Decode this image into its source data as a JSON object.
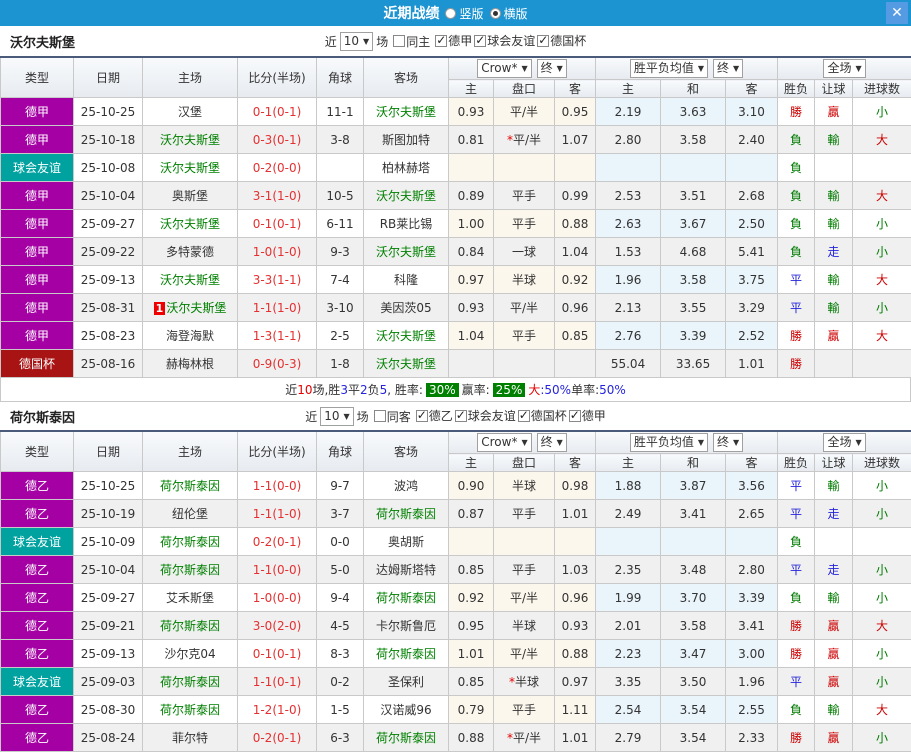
{
  "titlebar": {
    "title": "近期战绩",
    "radio_vertical": "竖版",
    "radio_horizontal": "横版",
    "close": "✕"
  },
  "colors": {
    "titlebar_blue": "#1d94d2",
    "close_button_blue": "#549be4",
    "team_name_green": "#008000",
    "score_red": "#e63030",
    "summary_badge_green": "#008000"
  },
  "type_colors": {
    "德甲": "#a400a4",
    "德乙": "#a400a4",
    "球会友谊": "#00a2a0",
    "德国杯": "#a81414"
  },
  "result_colors": {
    "勝": "#cc0000",
    "贏": "#cc0000",
    "大": "#cc0000",
    "平": "#2424dd",
    "走": "#2424dd",
    "負": "#007a00",
    "輸": "#007a00",
    "小": "#007a00"
  },
  "table_header": {
    "type": "类型",
    "date": "日期",
    "home": "主场",
    "score": "比分(半场)",
    "corner": "角球",
    "away": "客场",
    "odds_source": "Crow*",
    "odds_final": "终",
    "avg_source": "胜平负均值",
    "avg_final": "终",
    "scope": "全场",
    "odds_home": "主",
    "odds_line": "盘口",
    "odds_away": "客",
    "avg_home": "主",
    "avg_draw": "和",
    "avg_away": "客",
    "wdl": "胜负",
    "handicap": "让球",
    "goals": "进球数"
  },
  "teams": [
    {
      "name": "沃尔夫斯堡",
      "filter": {
        "near": "近",
        "games_count": "10",
        "games": "场",
        "same_label": "同主",
        "same_checked": false,
        "leagues": [
          {
            "label": "德甲",
            "checked": true
          },
          {
            "label": "球会友谊",
            "checked": true
          },
          {
            "label": "德国杯",
            "checked": true
          }
        ]
      },
      "rows": [
        {
          "type": "德甲",
          "date": "25-10-25",
          "home": "汉堡",
          "home_is_team": false,
          "score": "0-1(0-1)",
          "corner": "11-1",
          "away": "沃尔夫斯堡",
          "away_is_team": true,
          "odds": [
            "0.93",
            "平/半",
            "0.95"
          ],
          "avg": [
            "2.19",
            "3.63",
            "3.10"
          ],
          "result": [
            "勝",
            "贏",
            "小"
          ]
        },
        {
          "type": "德甲",
          "date": "25-10-18",
          "home": "沃尔夫斯堡",
          "home_is_team": true,
          "score": "0-3(0-1)",
          "corner": "3-8",
          "away": "斯图加特",
          "away_is_team": false,
          "odds": [
            "0.81",
            "*平/半",
            "1.07"
          ],
          "avg": [
            "2.80",
            "3.58",
            "2.40"
          ],
          "result": [
            "負",
            "輸",
            "大"
          ]
        },
        {
          "type": "球会友谊",
          "date": "25-10-08",
          "home": "沃尔夫斯堡",
          "home_is_team": true,
          "score": "0-2(0-0)",
          "corner": "",
          "away": "柏林赫塔",
          "away_is_team": false,
          "odds": [
            "",
            "",
            ""
          ],
          "avg": [
            "",
            "",
            ""
          ],
          "result": [
            "負",
            "",
            ""
          ]
        },
        {
          "type": "德甲",
          "date": "25-10-04",
          "home": "奥斯堡",
          "home_is_team": false,
          "score": "3-1(1-0)",
          "corner": "10-5",
          "away": "沃尔夫斯堡",
          "away_is_team": true,
          "odds": [
            "0.89",
            "平手",
            "0.99"
          ],
          "avg": [
            "2.53",
            "3.51",
            "2.68"
          ],
          "result": [
            "負",
            "輸",
            "大"
          ]
        },
        {
          "type": "德甲",
          "date": "25-09-27",
          "home": "沃尔夫斯堡",
          "home_is_team": true,
          "score": "0-1(0-1)",
          "corner": "6-11",
          "away": "RB莱比锡",
          "away_is_team": false,
          "odds": [
            "1.00",
            "平手",
            "0.88"
          ],
          "avg": [
            "2.63",
            "3.67",
            "2.50"
          ],
          "result": [
            "負",
            "輸",
            "小"
          ]
        },
        {
          "type": "德甲",
          "date": "25-09-22",
          "home": "多特蒙德",
          "home_is_team": false,
          "score": "1-0(1-0)",
          "corner": "9-3",
          "away": "沃尔夫斯堡",
          "away_is_team": true,
          "odds": [
            "0.84",
            "一球",
            "1.04"
          ],
          "avg": [
            "1.53",
            "4.68",
            "5.41"
          ],
          "result": [
            "負",
            "走",
            "小"
          ]
        },
        {
          "type": "德甲",
          "date": "25-09-13",
          "home": "沃尔夫斯堡",
          "home_is_team": true,
          "score": "3-3(1-1)",
          "corner": "7-4",
          "away": "科隆",
          "away_is_team": false,
          "odds": [
            "0.97",
            "半球",
            "0.92"
          ],
          "avg": [
            "1.96",
            "3.58",
            "3.75"
          ],
          "result": [
            "平",
            "輸",
            "大"
          ]
        },
        {
          "type": "德甲",
          "date": "25-08-31",
          "home": "沃尔夫斯堡",
          "home_is_team": true,
          "home_badge": "1",
          "score": "1-1(1-0)",
          "corner": "3-10",
          "away": "美因茨05",
          "away_is_team": false,
          "odds": [
            "0.93",
            "平/半",
            "0.96"
          ],
          "avg": [
            "2.13",
            "3.55",
            "3.29"
          ],
          "result": [
            "平",
            "輸",
            "小"
          ]
        },
        {
          "type": "德甲",
          "date": "25-08-23",
          "home": "海登海默",
          "home_is_team": false,
          "score": "1-3(1-1)",
          "corner": "2-5",
          "away": "沃尔夫斯堡",
          "away_is_team": true,
          "odds": [
            "1.04",
            "平手",
            "0.85"
          ],
          "avg": [
            "2.76",
            "3.39",
            "2.52"
          ],
          "result": [
            "勝",
            "贏",
            "大"
          ]
        },
        {
          "type": "德国杯",
          "date": "25-08-16",
          "home": "赫梅林根",
          "home_is_team": false,
          "score": "0-9(0-3)",
          "corner": "1-8",
          "away": "沃尔夫斯堡",
          "away_is_team": true,
          "odds": [
            "",
            "",
            ""
          ],
          "avg": [
            "55.04",
            "33.65",
            "1.01"
          ],
          "result": [
            "勝",
            "",
            ""
          ]
        }
      ],
      "summary": [
        {
          "t": "近",
          "c": "black"
        },
        {
          "t": "10",
          "c": "red"
        },
        {
          "t": "场,胜",
          "c": "black"
        },
        {
          "t": "3",
          "c": "blue"
        },
        {
          "t": "平",
          "c": "black"
        },
        {
          "t": "2",
          "c": "blue"
        },
        {
          "t": "负",
          "c": "black"
        },
        {
          "t": "5",
          "c": "blue"
        },
        {
          "t": ", 胜率:",
          "c": "black"
        },
        {
          "t": "30%",
          "c": "badge"
        },
        {
          "t": " 赢率:",
          "c": "black"
        },
        {
          "t": "25%",
          "c": "badge"
        },
        {
          "t": " 大",
          "c": "red"
        },
        {
          "t": ":",
          "c": "blue"
        },
        {
          "t": "50%",
          "c": "blue"
        },
        {
          "t": " 单率:",
          "c": "black"
        },
        {
          "t": "50%",
          "c": "blue"
        }
      ]
    },
    {
      "name": "荷尔斯泰因",
      "filter": {
        "near": "近",
        "games_count": "10",
        "games": "场",
        "same_label": "同客",
        "same_checked": false,
        "leagues": [
          {
            "label": "德乙",
            "checked": true
          },
          {
            "label": "球会友谊",
            "checked": true
          },
          {
            "label": "德国杯",
            "checked": true
          },
          {
            "label": "德甲",
            "checked": true
          }
        ]
      },
      "rows": [
        {
          "type": "德乙",
          "date": "25-10-25",
          "home": "荷尔斯泰因",
          "home_is_team": true,
          "score": "1-1(0-0)",
          "corner": "9-7",
          "away": "波鸿",
          "away_is_team": false,
          "odds": [
            "0.90",
            "半球",
            "0.98"
          ],
          "avg": [
            "1.88",
            "3.87",
            "3.56"
          ],
          "result": [
            "平",
            "輸",
            "小"
          ]
        },
        {
          "type": "德乙",
          "date": "25-10-19",
          "home": "纽伦堡",
          "home_is_team": false,
          "score": "1-1(1-0)",
          "corner": "3-7",
          "away": "荷尔斯泰因",
          "away_is_team": true,
          "odds": [
            "0.87",
            "平手",
            "1.01"
          ],
          "avg": [
            "2.49",
            "3.41",
            "2.65"
          ],
          "result": [
            "平",
            "走",
            "小"
          ]
        },
        {
          "type": "球会友谊",
          "date": "25-10-09",
          "home": "荷尔斯泰因",
          "home_is_team": true,
          "score": "0-2(0-1)",
          "corner": "0-0",
          "away": "奥胡斯",
          "away_is_team": false,
          "odds": [
            "",
            "",
            ""
          ],
          "avg": [
            "",
            "",
            ""
          ],
          "result": [
            "負",
            "",
            ""
          ]
        },
        {
          "type": "德乙",
          "date": "25-10-04",
          "home": "荷尔斯泰因",
          "home_is_team": true,
          "score": "1-1(0-0)",
          "corner": "5-0",
          "away": "达姆斯塔特",
          "away_is_team": false,
          "odds": [
            "0.85",
            "平手",
            "1.03"
          ],
          "avg": [
            "2.35",
            "3.48",
            "2.80"
          ],
          "result": [
            "平",
            "走",
            "小"
          ]
        },
        {
          "type": "德乙",
          "date": "25-09-27",
          "home": "艾禾斯堡",
          "home_is_team": false,
          "score": "1-0(0-0)",
          "corner": "9-4",
          "away": "荷尔斯泰因",
          "away_is_team": true,
          "odds": [
            "0.92",
            "平/半",
            "0.96"
          ],
          "avg": [
            "1.99",
            "3.70",
            "3.39"
          ],
          "result": [
            "負",
            "輸",
            "小"
          ]
        },
        {
          "type": "德乙",
          "date": "25-09-21",
          "home": "荷尔斯泰因",
          "home_is_team": true,
          "score": "3-0(2-0)",
          "corner": "4-5",
          "away": "卡尔斯鲁厄",
          "away_is_team": false,
          "odds": [
            "0.95",
            "半球",
            "0.93"
          ],
          "avg": [
            "2.01",
            "3.58",
            "3.41"
          ],
          "result": [
            "勝",
            "贏",
            "大"
          ]
        },
        {
          "type": "德乙",
          "date": "25-09-13",
          "home": "沙尔克04",
          "home_is_team": false,
          "score": "0-1(0-1)",
          "corner": "8-3",
          "away": "荷尔斯泰因",
          "away_is_team": true,
          "odds": [
            "1.01",
            "平/半",
            "0.88"
          ],
          "avg": [
            "2.23",
            "3.47",
            "3.00"
          ],
          "result": [
            "勝",
            "贏",
            "小"
          ]
        },
        {
          "type": "球会友谊",
          "date": "25-09-03",
          "home": "荷尔斯泰因",
          "home_is_team": true,
          "score": "1-1(0-1)",
          "corner": "0-2",
          "away": "圣保利",
          "away_is_team": false,
          "odds": [
            "0.85",
            "*半球",
            "0.97"
          ],
          "avg": [
            "3.35",
            "3.50",
            "1.96"
          ],
          "result": [
            "平",
            "贏",
            "小"
          ]
        },
        {
          "type": "德乙",
          "date": "25-08-30",
          "home": "荷尔斯泰因",
          "home_is_team": true,
          "score": "1-2(1-0)",
          "corner": "1-5",
          "away": "汉诺威96",
          "away_is_team": false,
          "odds": [
            "0.79",
            "平手",
            "1.11"
          ],
          "avg": [
            "2.54",
            "3.54",
            "2.55"
          ],
          "result": [
            "負",
            "輸",
            "大"
          ]
        },
        {
          "type": "德乙",
          "date": "25-08-24",
          "home": "菲尔特",
          "home_is_team": false,
          "score": "0-2(0-1)",
          "corner": "6-3",
          "away": "荷尔斯泰因",
          "away_is_team": true,
          "odds": [
            "0.88",
            "*平/半",
            "1.01"
          ],
          "avg": [
            "2.79",
            "3.54",
            "2.33"
          ],
          "result": [
            "勝",
            "贏",
            "小"
          ]
        }
      ]
    }
  ]
}
